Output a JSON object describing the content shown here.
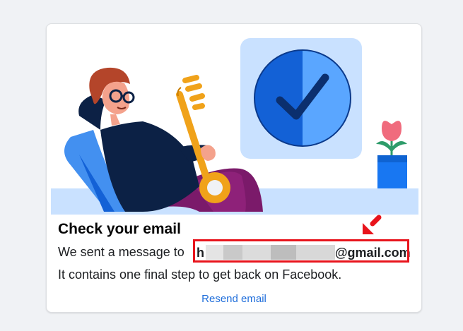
{
  "card": {
    "title": "Check your email",
    "sent_prefix": "We sent a message to ",
    "email_visible_start": "h",
    "email_visible_end": "@gmail.com",
    "instruction": "It contains one final step to get back on Facebook.",
    "resend_label": "Resend email"
  },
  "annotation": {
    "highlight_color": "#e8141c",
    "arrow_icon": "red-arrow-icon"
  },
  "colors": {
    "link": "#216fdb",
    "illustration_primary": "#1877f2",
    "illustration_light": "#c9e1ff"
  }
}
